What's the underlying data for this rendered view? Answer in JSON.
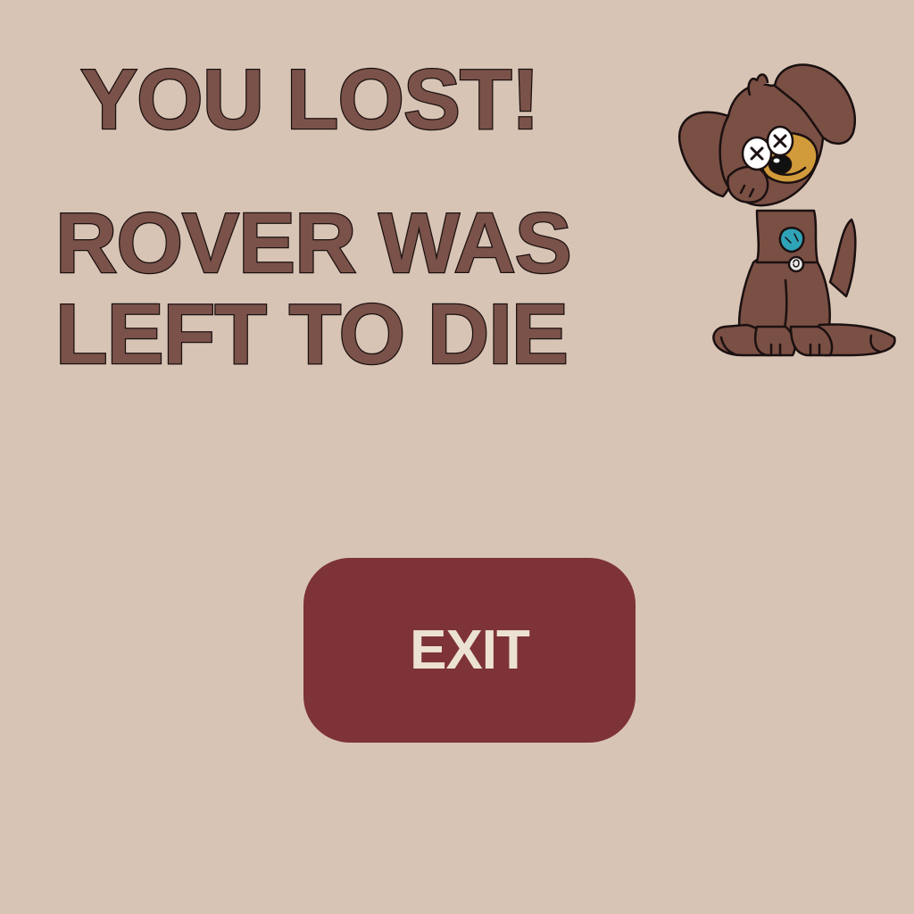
{
  "screen": {
    "title": "YOU LOST!",
    "message_lines": [
      "ROVER WAS",
      "LEFT TO DIE"
    ],
    "exit_label": "EXIT"
  },
  "colors": {
    "background": "#d8c4b5",
    "text_fill": "#7a5249",
    "text_outline": "#1a1010",
    "button_background": "#7d3337",
    "button_text": "#ece2d4",
    "dog_body": "#7a4f44",
    "dog_muzzle": "#d19a3a",
    "dog_collar": "#2fa3b8"
  },
  "icons": {
    "character": "dead-dog-icon"
  }
}
